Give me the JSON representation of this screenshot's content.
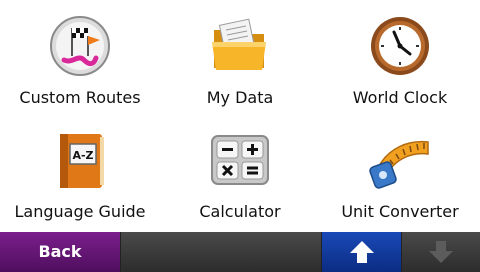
{
  "tiles": [
    {
      "label": "Custom Routes",
      "icon": "custom-routes-icon"
    },
    {
      "label": "My Data",
      "icon": "folder-icon"
    },
    {
      "label": "World Clock",
      "icon": "clock-icon"
    },
    {
      "label": "Language Guide",
      "icon": "book-icon"
    },
    {
      "label": "Calculator",
      "icon": "calculator-icon"
    },
    {
      "label": "Unit Converter",
      "icon": "tape-measure-icon"
    }
  ],
  "toolbar": {
    "back_label": "Back",
    "up_icon": "arrow-up-icon",
    "down_icon": "arrow-down-icon",
    "up_enabled": true,
    "down_enabled": false
  },
  "colors": {
    "back_button": "#6a1a7a",
    "up_button": "#1444a8",
    "toolbar": "#3b3b3b",
    "background": "#ffffff"
  }
}
